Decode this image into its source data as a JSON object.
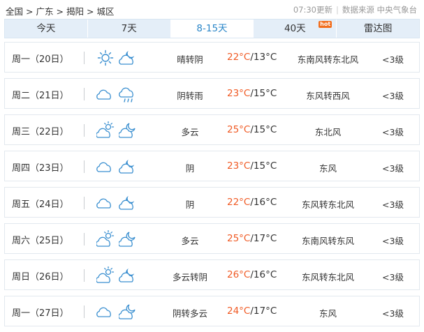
{
  "breadcrumb": {
    "items": [
      "全国",
      "广东",
      "揭阳",
      "城区"
    ],
    "separator": ">"
  },
  "update": {
    "time": "07:30更新",
    "separator": "|",
    "source": "数据来源 中央气象台"
  },
  "tabs": [
    {
      "label": "今天",
      "active": false
    },
    {
      "label": "7天",
      "active": false
    },
    {
      "label": "8-15天",
      "active": true
    },
    {
      "label": "40天",
      "active": false,
      "badge": "hot"
    },
    {
      "label": "雷达图",
      "active": false
    }
  ],
  "forecast": [
    {
      "day": "周一（20日）",
      "icon_day": "sunny-icon",
      "icon_night": "cloudy-night-moon-icon",
      "desc": "晴转阴",
      "high": "22°C",
      "low": "13°C",
      "wind": "东南风转东北风",
      "level": "<3级"
    },
    {
      "day": "周二（21日）",
      "icon_day": "overcast-cloud-icon",
      "icon_night": "rain-cloud-icon",
      "desc": "阴转雨",
      "high": "23°C",
      "low": "15°C",
      "wind": "东风转西风",
      "level": "<3级"
    },
    {
      "day": "周三（22日）",
      "icon_day": "partly-cloudy-day-icon",
      "icon_night": "partly-cloudy-night-icon",
      "desc": "多云",
      "high": "25°C",
      "low": "15°C",
      "wind": "东北风",
      "level": "<3级"
    },
    {
      "day": "周四（23日）",
      "icon_day": "overcast-cloud-icon",
      "icon_night": "cloudy-night-moon-icon",
      "desc": "阴",
      "high": "23°C",
      "low": "15°C",
      "wind": "东风",
      "level": "<3级"
    },
    {
      "day": "周五（24日）",
      "icon_day": "overcast-cloud-icon",
      "icon_night": "cloudy-night-moon-icon",
      "desc": "阴",
      "high": "22°C",
      "low": "16°C",
      "wind": "东风转东北风",
      "level": "<3级"
    },
    {
      "day": "周六（25日）",
      "icon_day": "partly-cloudy-day-icon",
      "icon_night": "partly-cloudy-night-icon",
      "desc": "多云",
      "high": "25°C",
      "low": "17°C",
      "wind": "东南风转东风",
      "level": "<3级"
    },
    {
      "day": "周日（26日）",
      "icon_day": "partly-cloudy-day-icon",
      "icon_night": "cloudy-night-moon-icon",
      "desc": "多云转阴",
      "high": "26°C",
      "low": "16°C",
      "wind": "东风转东北风",
      "level": "<3级"
    },
    {
      "day": "周一（27日）",
      "icon_day": "overcast-cloud-icon",
      "icon_night": "partly-cloudy-night-icon",
      "desc": "阴转多云",
      "high": "24°C",
      "low": "17°C",
      "wind": "东风",
      "level": "<3级"
    }
  ],
  "colors": {
    "high_temp": "#f05a24",
    "active_tab_text": "#2a86c8",
    "tab_bg": "#e4eef8",
    "hot_badge": "#f26e1d",
    "icon_stroke": "#3a8fd0"
  }
}
